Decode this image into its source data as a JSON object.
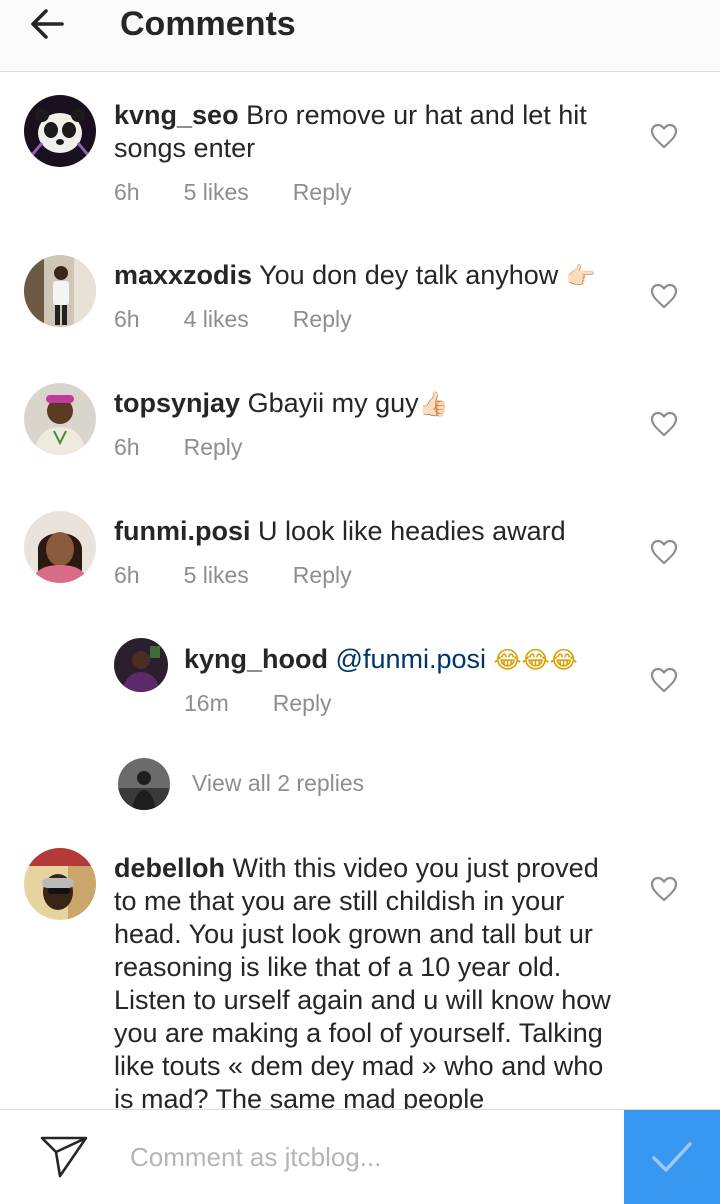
{
  "header": {
    "title": "Comments",
    "back_icon": "arrow-left-icon"
  },
  "comments": [
    {
      "username": "kvng_seo",
      "text": "Bro remove ur hat and let hit songs enter",
      "time": "6h",
      "likes": "5 likes",
      "reply": "Reply"
    },
    {
      "username": "maxxzodis",
      "text": "You don dey talk anyhow",
      "emoji": "👉🏻",
      "time": "6h",
      "likes": "4 likes",
      "reply": "Reply"
    },
    {
      "username": "topsynjay",
      "text": "Gbayii my guy",
      "emoji": "👍🏻",
      "time": "6h",
      "reply": "Reply"
    },
    {
      "username": "funmi.posi",
      "text": "U look like headies award",
      "time": "6h",
      "likes": "5 likes",
      "reply": "Reply"
    },
    {
      "username": "debelloh",
      "text": "With this video you just proved to me that you are still childish in your head. You just look grown and tall but ur reasoning is like that of a 10 year old. Listen to urself again and u will know how you are making a fool of yourself. Talking like touts «  dem dey mad » who and who is mad? The same mad people"
    }
  ],
  "reply_item": {
    "username": "kyng_hood",
    "mention": "@funmi.posi",
    "emoji": "😂😂😂",
    "time": "16m",
    "reply": "Reply"
  },
  "view_replies": "View all 2 replies",
  "composer": {
    "placeholder": "Comment as jtcblog...",
    "send_icon": "direct-send-icon",
    "post_icon": "checkmark-icon"
  },
  "colors": {
    "accent": "#3897f0",
    "mention": "#003569",
    "meta": "#8e8e8e",
    "text": "#262626"
  }
}
